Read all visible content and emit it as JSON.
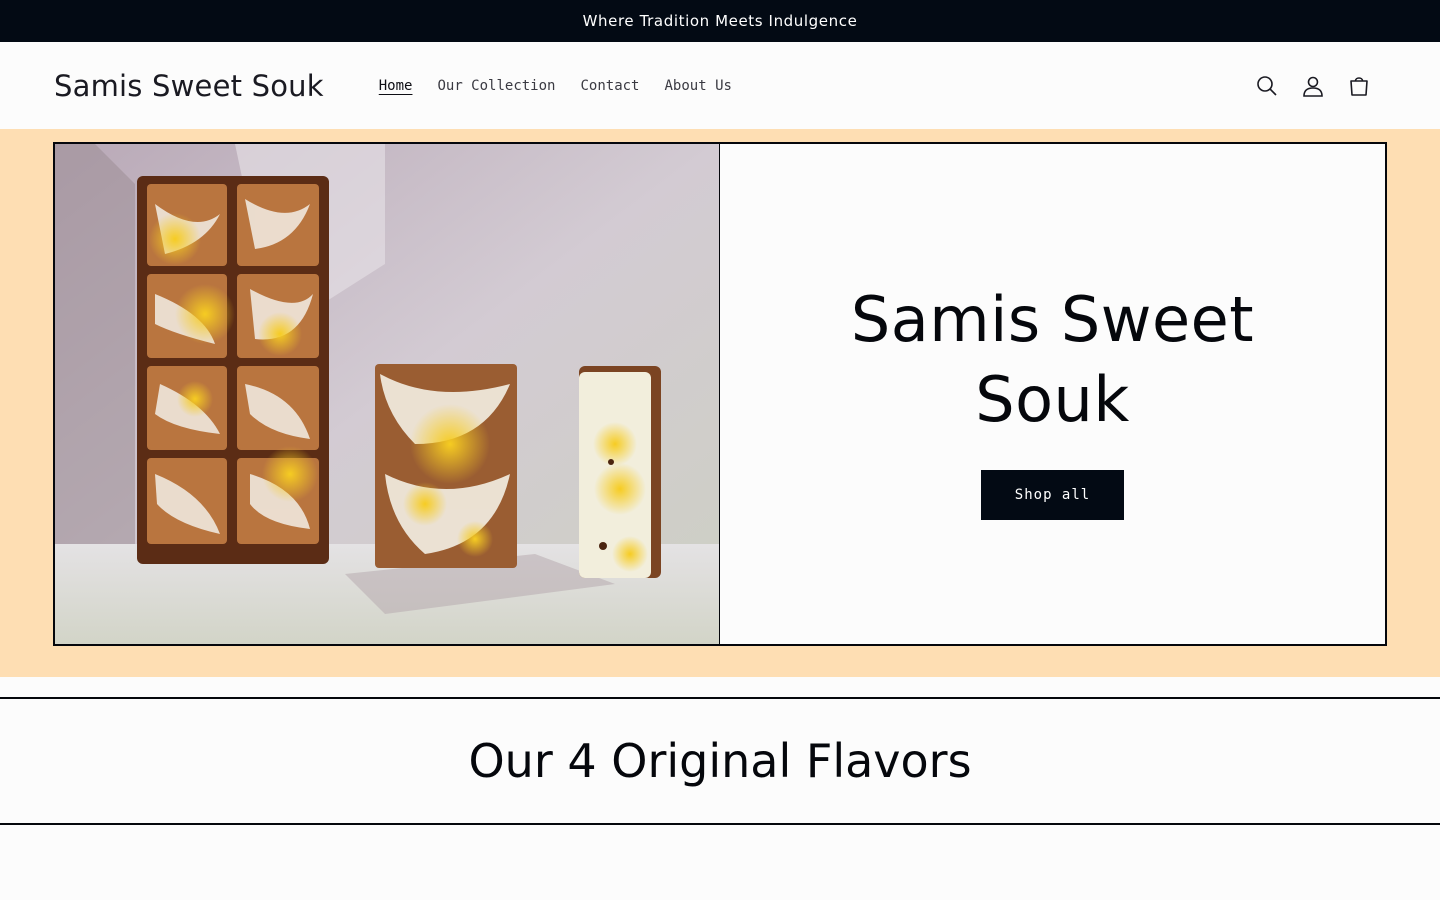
{
  "announcement": "Where Tradition Meets Indulgence",
  "header": {
    "logo": "Samis Sweet Souk",
    "nav": [
      {
        "label": "Home",
        "active": true
      },
      {
        "label": "Our Collection",
        "active": false
      },
      {
        "label": "Contact",
        "active": false
      },
      {
        "label": "About Us",
        "active": false
      }
    ],
    "icons": [
      "search-icon",
      "account-icon",
      "cart-icon"
    ]
  },
  "hero": {
    "title": "Samis Sweet Souk",
    "button_label": "Shop all"
  },
  "section": {
    "heading": "Our 4 Original Flavors"
  },
  "colors": {
    "announcement_bg": "#030a14",
    "hero_band": "#fedeb3",
    "button_bg": "#030a14"
  }
}
